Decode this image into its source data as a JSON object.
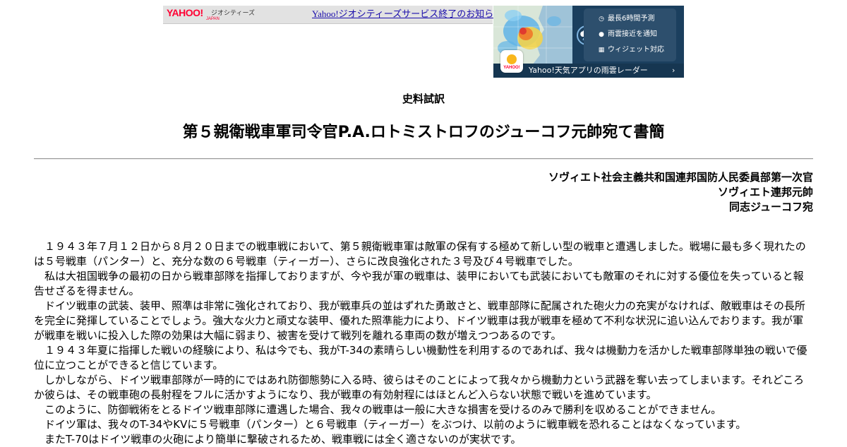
{
  "header": {
    "logo_text": "YAHOO!",
    "logo_sub": "JAPAN",
    "service_name": "ジオシティーズ",
    "notice_link": "Yahoo!ジオシティーズサービス終了のお知らせ"
  },
  "ad": {
    "features": [
      {
        "icon": "clock-icon",
        "label": "最長6時間予測"
      },
      {
        "icon": "pin-icon",
        "label": "雨雲接近を通知"
      },
      {
        "icon": "widget-icon",
        "label": "ウィジェット対応"
      }
    ],
    "app_icon_label": "YAHOO!",
    "cta": "Yahoo!天気アプリの雨雲レーダー",
    "arrow": "›"
  },
  "document": {
    "kicker": "史料試訳",
    "title": "第５親衛戦車軍司令官P.A.ロトミストロフのジューコフ元帥宛て書簡",
    "addressee": [
      "ソヴィエト社会主義共和国連邦国防人民委員部第一次官",
      "ソヴィエト連邦元帥",
      "同志ジューコフ宛"
    ],
    "paragraphs": [
      "１９４３年７月１２日から８月２０日までの戦車戦において、第５親衛戦車軍は敵軍の保有する極めて新しい型の戦車と遭遇しました。戦場に最も多く現れたのは５号戦車（パンター）と、充分な数の６号戦車（ティーガー）、さらに改良強化された３号及び４号戦車でした。",
      "私は大祖国戦争の最初の日から戦車部隊を指揮しておりますが、今や我が軍の戦車は、装甲においても武装においても敵軍のそれに対する優位を失っていると報告せざるを得ません。",
      "ドイツ戦車の武装、装甲、照準は非常に強化されており、我が戦車兵の並はずれた勇敢さと、戦車部隊に配属された砲火力の充実がなければ、敵戦車はその長所を完全に発揮していることでしょう。強大な火力と頑丈な装甲、優れた照準能力により、ドイツ戦車は我が戦車を極めて不利な状況に追い込んでおります。我が軍が戦車を戦いに投入した際の効果は大幅に弱まり、被害を受けて戦列を離れる車両の数が増えつつあるのです。",
      "１９４３年夏に指揮した戦いの経験により、私は今でも、我がT-34の素晴らしい機動性を利用するのであれば、我々は機動力を活かした戦車部隊単独の戦いで優位に立つことができると信じています。",
      "しかしながら、ドイツ戦車部隊が一時的にではあれ防御態勢に入る時、彼らはそのことによって我々から機動力という武器を奪い去ってしまいます。それどころか彼らは、その戦車砲の長射程をフルに活かすようになり、我が戦車の有効射程にはほとんど入らない状態で戦いを進めています。",
      "このように、防御戦術をとるドイツ戦車部隊に遭遇した場合、我々の戦車は一般に大きな損害を受けるのみで勝利を収めることができません。",
      "ドイツ軍は、我々のT-34やKVに５号戦車（パンター）と６号戦車（ティーガー）をぶつけ、以前のように戦車戦を恐れることはなくなっています。",
      "またT-70はドイツ戦車の火砲により簡単に撃破されるため、戦車戦には全く適さないのが実状です。"
    ]
  },
  "colors": {
    "link": "#1a0dab",
    "yahoo_red": "#ff0033",
    "ad_bg": "#1b3f5e",
    "rule": "#9a9a9a"
  }
}
